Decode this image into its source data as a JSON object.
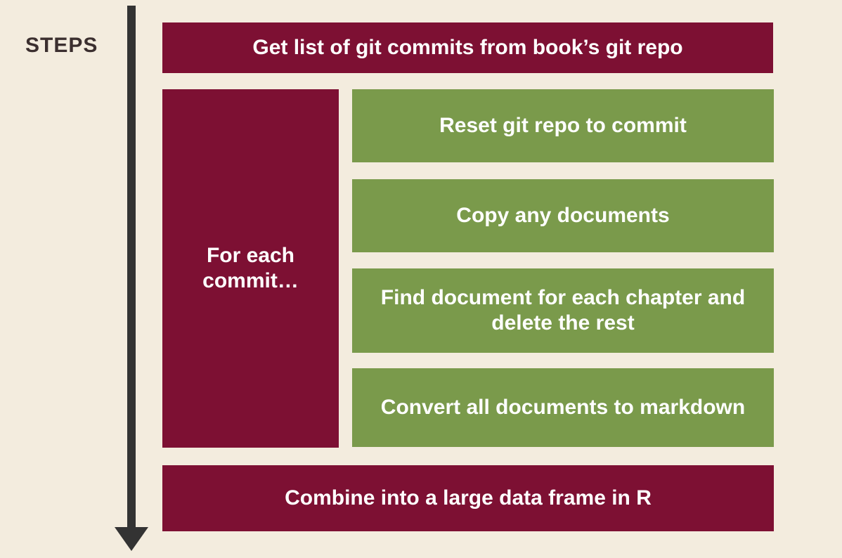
{
  "label": "STEPS",
  "step_top": "Get list of git commits from book’s git repo",
  "for_each": "For each commit…",
  "substeps": {
    "s1": "Reset git repo to commit",
    "s2": "Copy any documents",
    "s3": "Find document for each chapter and delete the rest",
    "s4": "Convert all documents to markdown"
  },
  "step_bottom": "Combine into a large data frame in R"
}
